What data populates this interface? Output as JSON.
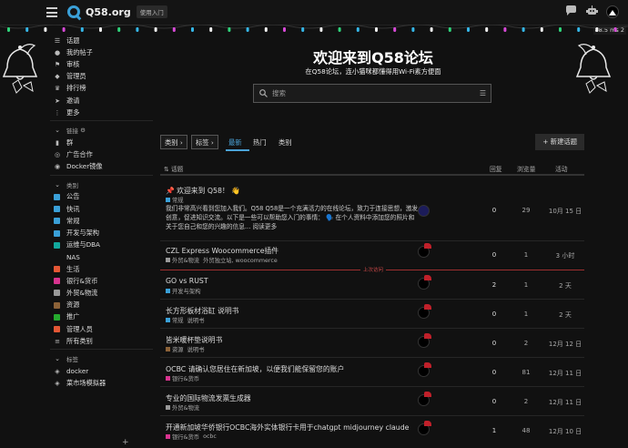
{
  "header": {
    "logo_text": "Q58.org",
    "tag": "使用入门",
    "status_mini": "88.5 ms 2",
    "icons": [
      "chat-icon",
      "robot-icon",
      "avatar"
    ]
  },
  "sidebar": {
    "items": [
      {
        "icon": "list-icon",
        "label": "话题"
      },
      {
        "icon": "user-icon",
        "label": "我的帖子"
      },
      {
        "icon": "flag-icon",
        "label": "审核"
      },
      {
        "icon": "admin-icon",
        "label": "管理员"
      },
      {
        "icon": "crown-icon",
        "label": "排行榜"
      },
      {
        "icon": "send-icon",
        "label": "邀请"
      },
      {
        "icon": "more-icon",
        "label": "更多"
      }
    ],
    "links_header": "链接",
    "links": [
      {
        "icon": "chart-icon",
        "label": "群"
      },
      {
        "icon": "ad-icon",
        "label": "广告合作"
      },
      {
        "icon": "github-icon",
        "label": "Docker镜像"
      }
    ],
    "cats_header": "类别",
    "categories": [
      {
        "label": "公告",
        "color": "#3aa0d8"
      },
      {
        "label": "快讯",
        "color": "#3aa0d8"
      },
      {
        "label": "常规",
        "color": "#3aa0d8"
      },
      {
        "label": "开发与架构",
        "color": "#3aa0d8"
      },
      {
        "label": "运维与DBA",
        "color": "#12a89d"
      },
      {
        "label": "NAS",
        "color": ""
      },
      {
        "label": "生活",
        "color": "#e45735"
      },
      {
        "label": "银行&货币",
        "color": "#d8338f"
      },
      {
        "label": "外贸&物流",
        "color": "#999999"
      },
      {
        "label": "资源",
        "color": "#8c6238"
      },
      {
        "label": "推广",
        "color": "#25aa2e"
      },
      {
        "label": "管理人员",
        "color": "#e45735"
      }
    ],
    "all_cats": "所有类别",
    "tags_header": "标签",
    "tags": [
      {
        "label": "docker"
      },
      {
        "label": "菜市场模拟器"
      }
    ]
  },
  "hero": {
    "title": "欢迎来到Q58论坛",
    "subtitle": "在Q58论坛，连小猫咪都懂得用Wi-Fi素方便面",
    "search_placeholder": "搜索"
  },
  "nav": {
    "category_dd": "类别",
    "tags_dd": "标签",
    "tabs": [
      "最新",
      "热门",
      "类别"
    ],
    "new_topic": "+ 新建话题"
  },
  "list": {
    "headers": {
      "topic": "话题",
      "replies": "回复",
      "views": "浏览量",
      "activity": "活动"
    },
    "last_visit": "上次访问",
    "rows": [
      {
        "title": "📌 欢迎来到 Q58！ 👋",
        "tags": [
          {
            "text": "常规",
            "color": "#3aa0d8"
          }
        ],
        "excerpt": "我们非常高兴看到您加入我们。Q58 Q58是一个充满活力的在线论坛，致力于连接思想，激发创意，促进知识交流。以下是一些可以帮助您入门的事情： 🗣️ 在个人资料中添加您的照片和关于您自己和您的兴趣的信息... 阅读更多",
        "replies": "0",
        "views": "29",
        "activity": "10月 15 日"
      },
      {
        "title": "CZL Express Woocommerce插件",
        "tags": [
          {
            "text": "外贸&物流",
            "color": "#999999"
          },
          {
            "text": "外贸独立站, woocommerce",
            "color": ""
          }
        ],
        "replies": "0",
        "views": "1",
        "activity": "3 小时"
      },
      {
        "title": "GO vs RUST",
        "tags": [
          {
            "text": "开发与架构",
            "color": "#3aa0d8"
          }
        ],
        "replies": "2",
        "views": "1",
        "activity": "2 天"
      },
      {
        "title": "长方形板材浴缸 说明书",
        "tags": [
          {
            "text": "常规",
            "color": "#3aa0d8"
          },
          {
            "text": "说明书",
            "color": ""
          }
        ],
        "replies": "0",
        "views": "1",
        "activity": "2 天"
      },
      {
        "title": "皆米暖杯垫说明书",
        "tags": [
          {
            "text": "资源",
            "color": "#8c6238"
          },
          {
            "text": "说明书",
            "color": ""
          }
        ],
        "replies": "0",
        "views": "2",
        "activity": "12月 12 日"
      },
      {
        "title": "OCBC 请确认您居住在新加坡，以便我们能保留您的账户",
        "tags": [
          {
            "text": "银行&货币",
            "color": "#d8338f"
          }
        ],
        "replies": "0",
        "views": "81",
        "activity": "12月 11 日"
      },
      {
        "title": "专业的国际物流发票生成器",
        "tags": [
          {
            "text": "外贸&物流",
            "color": "#999999"
          }
        ],
        "replies": "0",
        "views": "2",
        "activity": "12月 11 日"
      },
      {
        "title": "开通新加坡华侨银行OCBC海外实体银行卡用于chatgpt midjourney claude",
        "tags": [
          {
            "text": "银行&货币",
            "color": "#d8338f"
          },
          {
            "text": "ocbc",
            "color": ""
          }
        ],
        "replies": "1",
        "views": "48",
        "activity": "12月 10 日"
      }
    ]
  },
  "colors": {
    "accent": "#4ba3d8",
    "background": "#111111",
    "last_visit_line": "#9d2f2f"
  }
}
